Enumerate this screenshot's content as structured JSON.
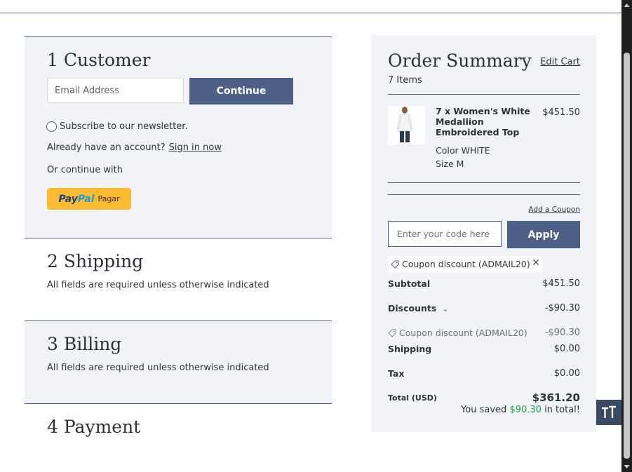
{
  "checkout": {
    "customer": {
      "title": "1 Customer",
      "email_placeholder": "Email Address",
      "continue_label": "Continue",
      "newsletter_label": "Subscribe to our newsletter.",
      "account_prompt": "Already have an account?",
      "sign_in_link": "Sign in now",
      "or_continue": "Or continue with",
      "paypal_brand_a": "Pay",
      "paypal_brand_b": "Pal",
      "paypal_action": "Pagar"
    },
    "shipping": {
      "title": "2 Shipping",
      "note": "All fields are required unless otherwise indicated"
    },
    "billing": {
      "title": "3 Billing",
      "note": "All fields are required unless otherwise indicated"
    },
    "payment": {
      "title": "4 Payment"
    }
  },
  "summary": {
    "title": "Order Summary",
    "edit_cart": "Edit Cart",
    "items_count": "7 Items",
    "product": {
      "name": "7 x Women's White Medallion Embroidered Top",
      "price": "$451.50",
      "color": "Color WHITE",
      "size": "Size M"
    },
    "add_coupon": "Add a Coupon",
    "coupon_placeholder": "Enter your code here",
    "apply_label": "Apply",
    "applied_coupon": "Coupon discount (ADMAIL20)",
    "subtotal_label": "Subtotal",
    "subtotal_value": "$451.50",
    "discounts_label": "Discounts",
    "discounts_value": "-$90.30",
    "coupon_line_label": "Coupon discount (ADMAIL20)",
    "coupon_line_value": "-$90.30",
    "shipping_label": "Shipping",
    "shipping_value": "$0.00",
    "tax_label": "Tax",
    "tax_value": "$0.00",
    "total_label": "Total (USD)",
    "total_value": "$361.20",
    "saved_prefix": "You saved",
    "saved_amount": "$90.30",
    "saved_suffix": "in total!"
  },
  "colors": {
    "accent": "#4d6088",
    "panel": "#f1f3f6",
    "savings": "#1aa74a",
    "paypal": "#fcbb32"
  },
  "icons": [
    "radio-button",
    "tag-icon",
    "close-icon",
    "chevron-down-icon",
    "text-size-icon"
  ]
}
